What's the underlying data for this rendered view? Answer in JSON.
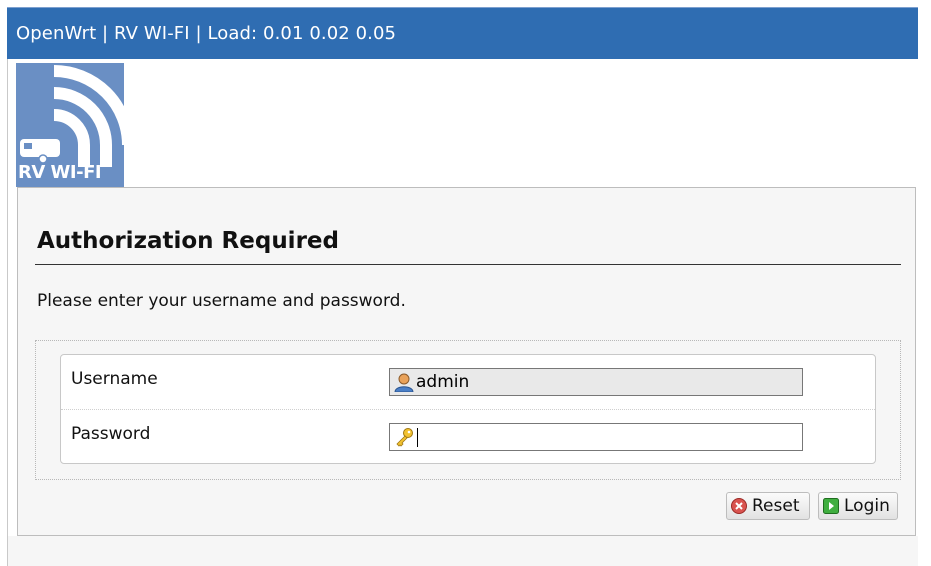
{
  "header": {
    "title": "OpenWrt | RV WI-FI | Load: 0.01 0.02 0.05"
  },
  "logo": {
    "text": "RV WI-FI"
  },
  "auth": {
    "title": "Authorization Required",
    "description": "Please enter your username and password.",
    "username_label": "Username",
    "username_value": "admin",
    "password_label": "Password",
    "password_value": ""
  },
  "buttons": {
    "reset_label": "Reset",
    "login_label": "Login"
  },
  "colors": {
    "header_bg": "#2f6db2",
    "logo_bg": "#6a8fc4"
  },
  "icons": {
    "user": "user-icon",
    "key": "key-icon",
    "reset": "reset-icon",
    "login": "login-icon"
  }
}
